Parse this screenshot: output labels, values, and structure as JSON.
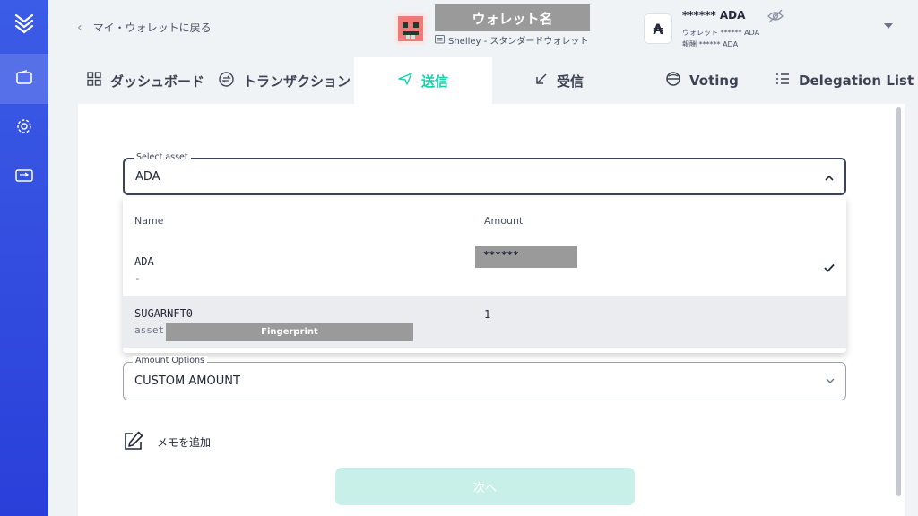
{
  "colors": {
    "sidebar": "#3b5ce6",
    "accent": "#17d1aa",
    "next_disabled": "#c9f0e8",
    "redaction": "#9a9a9a"
  },
  "sidebar": {
    "logo_icon": "yoroi-logo-icon",
    "items": [
      {
        "name": "wallet",
        "icon": "wallet-icon",
        "active": true
      },
      {
        "name": "settings",
        "icon": "gear-icon",
        "active": false
      },
      {
        "name": "transfer",
        "icon": "transfer-icon",
        "active": false
      }
    ]
  },
  "header": {
    "back_label": "マイ・ウォレットに戻る",
    "wallet_name": "ウォレット名",
    "wallet_type": "Shelley - スタンダードウォレット",
    "currency_symbol": "₳",
    "balance": "****** ADA",
    "balance_wallet_line": "ウォレット ****** ADA",
    "balance_reward_line": "報酬 ****** ADA"
  },
  "tabs": [
    {
      "label": "ダッシュボード",
      "icon": "dashboard-icon"
    },
    {
      "label": "トランザクション",
      "icon": "transactions-icon"
    },
    {
      "label": "送信",
      "icon": "send-icon",
      "active": true
    },
    {
      "label": "受信",
      "icon": "receive-icon"
    },
    {
      "label": "Voting",
      "icon": "voting-icon"
    },
    {
      "label": "Delegation List",
      "icon": "list-icon"
    }
  ],
  "send_form": {
    "select_asset_label": "Select asset",
    "selected_asset": "ADA",
    "columns": {
      "name": "Name",
      "amount": "Amount"
    },
    "assets": [
      {
        "name": "ADA",
        "sub": "-",
        "amount": "******",
        "selected": true
      },
      {
        "name": "SUGARNFT0",
        "sub": "asset",
        "sub_redacted": "Fingerprint",
        "amount": "1",
        "selected": false
      }
    ],
    "amount_options_label": "Amount Options",
    "amount_option": "CUSTOM AMOUNT",
    "memo_label": "メモを追加",
    "next_label": "次へ"
  }
}
